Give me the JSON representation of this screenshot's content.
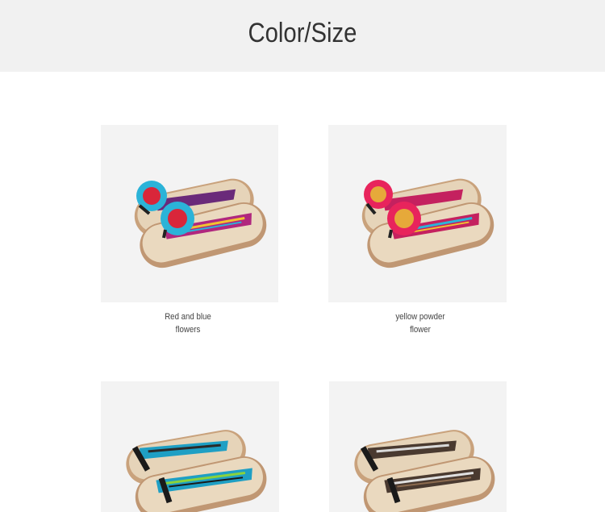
{
  "header": {
    "title": "Color/Size"
  },
  "products": [
    {
      "caption_line1": "Red and blue",
      "caption_line2": "flowers",
      "icon": "flower-flip-flop-image",
      "colors": {
        "flower": "#2bb3d8",
        "center": "#d9263a",
        "strap": "#b0277e"
      }
    },
    {
      "caption_line1": "yellow powder",
      "caption_line2": "flower",
      "icon": "flower-flip-flop-image",
      "colors": {
        "flower": "#e8245c",
        "center": "#e6a93a",
        "strap": "#c4215f"
      }
    },
    {
      "caption_line1": "",
      "caption_line2": "",
      "icon": "flip-flop-image",
      "colors": {
        "strap": "#1f9fc4"
      }
    },
    {
      "caption_line1": "",
      "caption_line2": "",
      "icon": "flip-flop-image",
      "colors": {
        "strap": "#4a3a30"
      }
    }
  ]
}
